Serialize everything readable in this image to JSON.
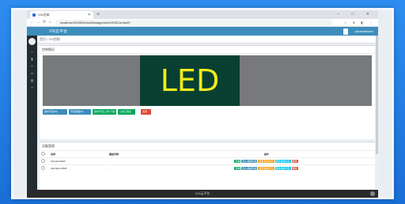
{
  "browser": {
    "tab_title": "VIX总体",
    "url": "localhost:9918/DeviceManagement/VMSControl/9",
    "win_controls": "–  □  ✕"
  },
  "app": {
    "title": "VIX云平台",
    "user": "Administrator"
  },
  "breadcrumb": "首页 / VIX控制",
  "control_box": {
    "title": "控制情况",
    "led_text": "LED",
    "buttons": [
      "发布节目(M)",
      "节目管理(M)",
      "发布节目(上传/下载)",
      "小窗口测试",
      "关闭"
    ]
  },
  "device_box": {
    "title": "设备管理",
    "columns": [
      "名称",
      "播放列表",
      "操作"
    ],
    "rows": [
      {
        "name": "2021115.BMP",
        "list": "-"
      },
      {
        "name": "AECSE11.BMP",
        "list": "-"
      }
    ],
    "ops": [
      "查看",
      "加入播放列表",
      "更新播放列表",
      "更新播放列表",
      "删除"
    ]
  },
  "footer": "VIX云平台",
  "colors": {
    "background": "#1a7be0",
    "header": "#3c8dbc",
    "sidebar": "#222d32",
    "led_bg": "#0a4d3c",
    "led_text": "#f0ec1a"
  }
}
